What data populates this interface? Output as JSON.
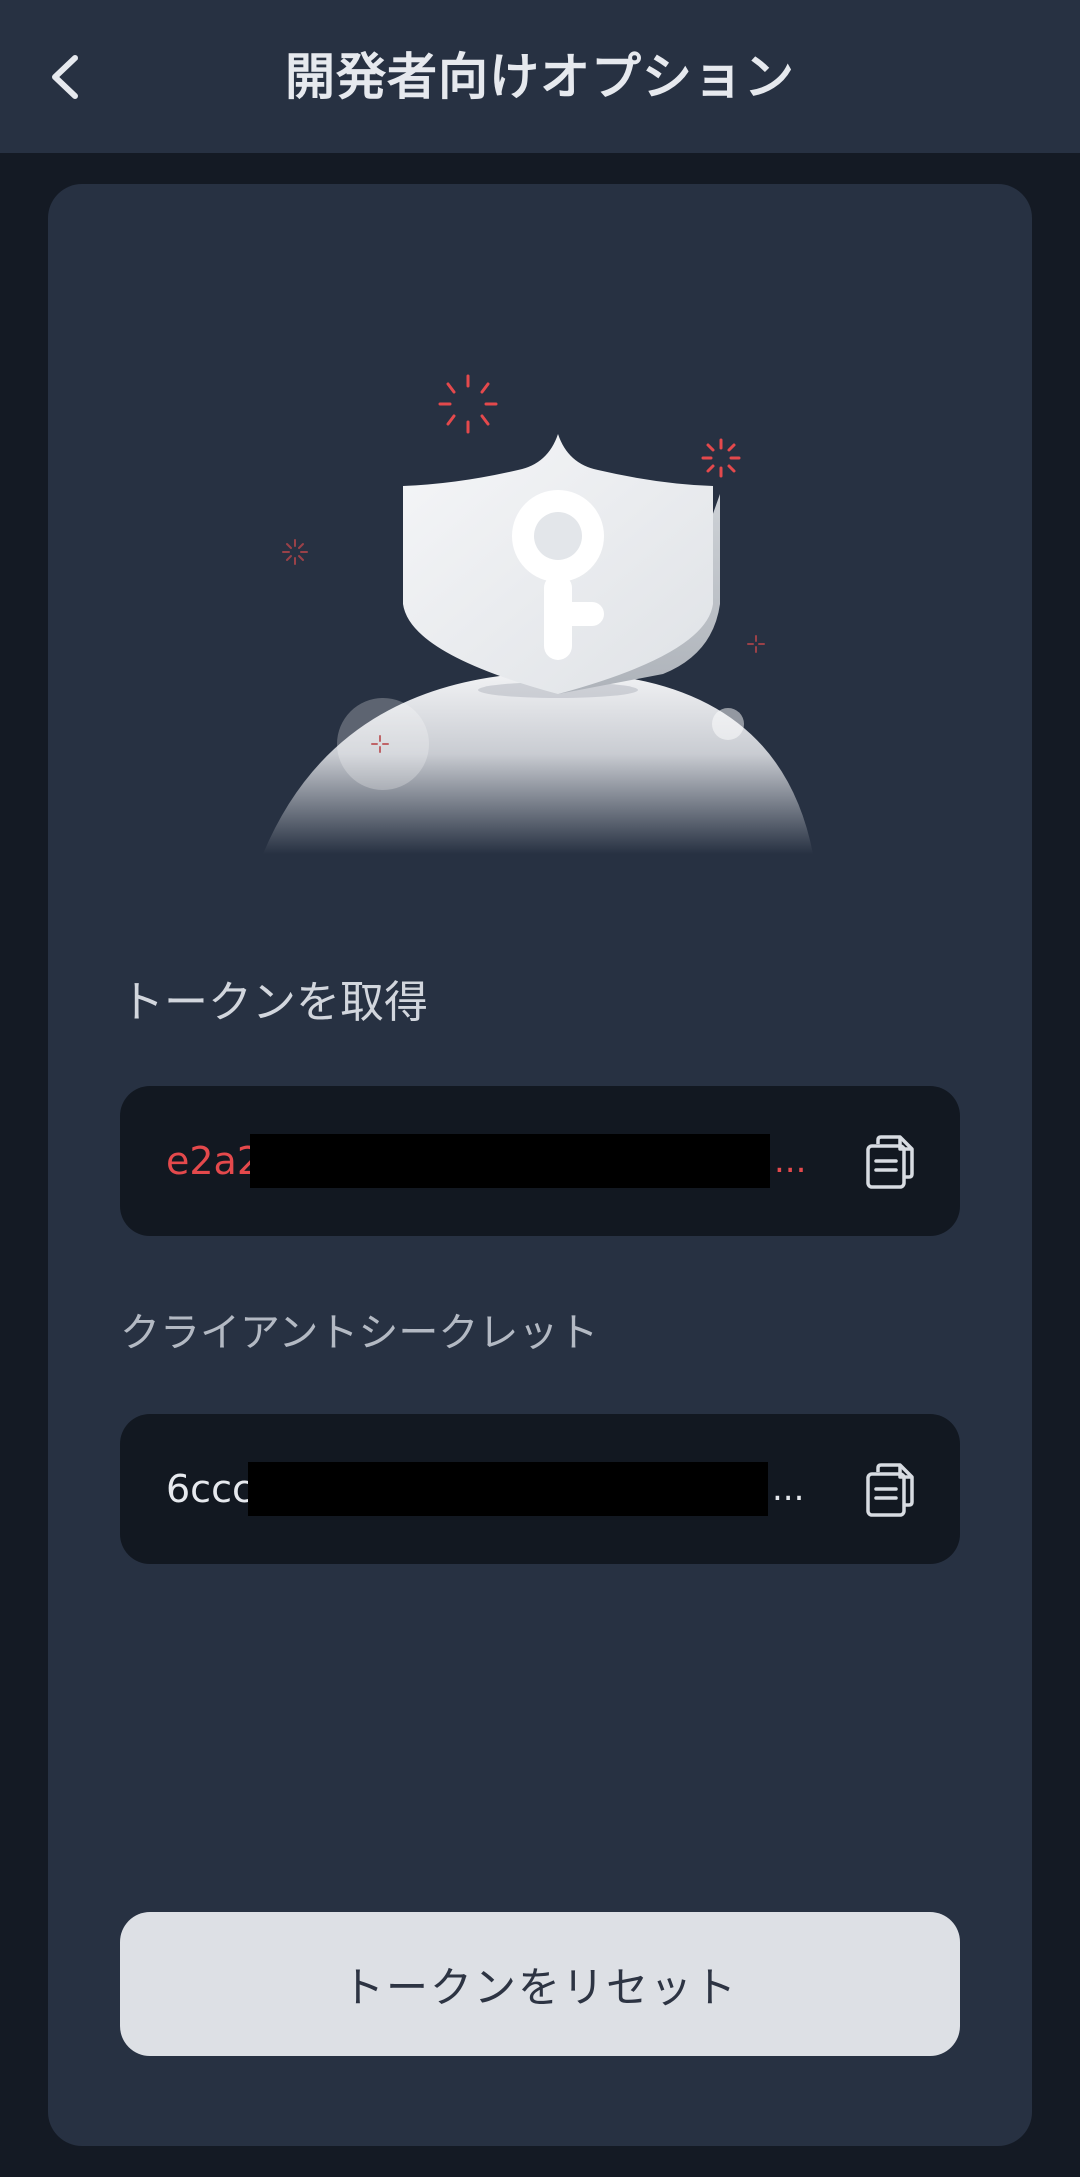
{
  "header": {
    "title": "開発者向けオプション",
    "back_icon": "chevron-left-icon"
  },
  "token": {
    "label": "トークンを取得",
    "value_visible": "e2a2",
    "ellipsis": "...",
    "copy_icon": "copy-icon",
    "value_color": "#e4494c"
  },
  "secret": {
    "label": "クライアントシークレット",
    "value_visible": "6ccc",
    "ellipsis": "...",
    "copy_icon": "copy-icon"
  },
  "reset_button": {
    "label": "トークンをリセット"
  },
  "colors": {
    "background": "#141a24",
    "card": "#273142",
    "field": "#121821",
    "accent_red": "#e4494c",
    "button": "#dde0e5"
  }
}
